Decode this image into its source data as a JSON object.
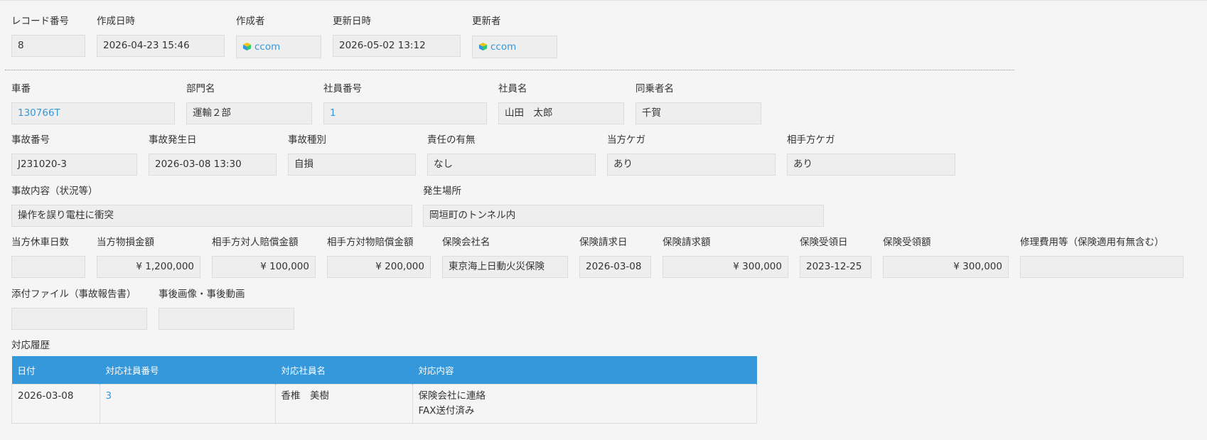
{
  "header": {
    "record_no": {
      "label": "レコード番号",
      "value": "8"
    },
    "created_at": {
      "label": "作成日時",
      "value": "2026-04-23 15:46"
    },
    "creator": {
      "label": "作成者",
      "value": "ccom"
    },
    "updated_at": {
      "label": "更新日時",
      "value": "2026-05-02 13:12"
    },
    "updater": {
      "label": "更新者",
      "value": "ccom"
    }
  },
  "row1": {
    "car_no": {
      "label": "車番",
      "value": "130766T"
    },
    "dept": {
      "label": "部門名",
      "value": "運輸２部"
    },
    "emp_no": {
      "label": "社員番号",
      "value": "1"
    },
    "emp_name": {
      "label": "社員名",
      "value": "山田　太郎"
    },
    "passenger": {
      "label": "同乗者名",
      "value": "千賀"
    }
  },
  "row2": {
    "accident_no": {
      "label": "事故番号",
      "value": "J231020-3"
    },
    "occurred_at": {
      "label": "事故発生日",
      "value": "2026-03-08 13:30"
    },
    "accident_type": {
      "label": "事故種別",
      "value": "自損"
    },
    "liability": {
      "label": "責任の有無",
      "value": "なし"
    },
    "own_injury": {
      "label": "当方ケガ",
      "value": "あり"
    },
    "other_injury": {
      "label": "相手方ケガ",
      "value": "あり"
    }
  },
  "row3": {
    "content": {
      "label": "事故内容（状況等）",
      "value": "操作を誤り電柱に衝突"
    },
    "place": {
      "label": "発生場所",
      "value": "岡垣町のトンネル内"
    }
  },
  "row4": {
    "days_off": {
      "label": "当方休車日数",
      "value": ""
    },
    "own_damage": {
      "label": "当方物損金額",
      "value": "¥ 1,200,000"
    },
    "other_personal": {
      "label": "相手方対人賠償金額",
      "value": "¥ 100,000"
    },
    "other_property": {
      "label": "相手方対物賠償金額",
      "value": "¥ 200,000"
    },
    "insurer": {
      "label": "保険会社名",
      "value": "東京海上日動火災保険"
    },
    "claim_date": {
      "label": "保険請求日",
      "value": "2026-03-08"
    },
    "claim_amount": {
      "label": "保険請求額",
      "value": "¥ 300,000"
    },
    "receipt_date": {
      "label": "保険受領日",
      "value": "2023-12-25"
    },
    "receipt_amount": {
      "label": "保険受領額",
      "value": "¥ 300,000"
    },
    "repair_cost": {
      "label": "修理費用等（保険適用有無含む）",
      "value": ""
    }
  },
  "row5": {
    "attachment": {
      "label": "添付ファイル（事故報告書）",
      "value": ""
    },
    "media": {
      "label": "事後画像・事後動画",
      "value": ""
    }
  },
  "history": {
    "label": "対応履歴",
    "columns": [
      "日付",
      "対応社員番号",
      "対応社員名",
      "対応内容"
    ],
    "rows": [
      {
        "date": "2026-03-08",
        "emp_no": "3",
        "emp_name": "香椎　美樹",
        "content_line1": "保険会社に連絡",
        "content_line2": "FAX送付済み"
      }
    ]
  },
  "colors": {
    "accent": "#3498db",
    "field_bg": "#eeeeee",
    "page_bg": "#f5f5f5"
  }
}
